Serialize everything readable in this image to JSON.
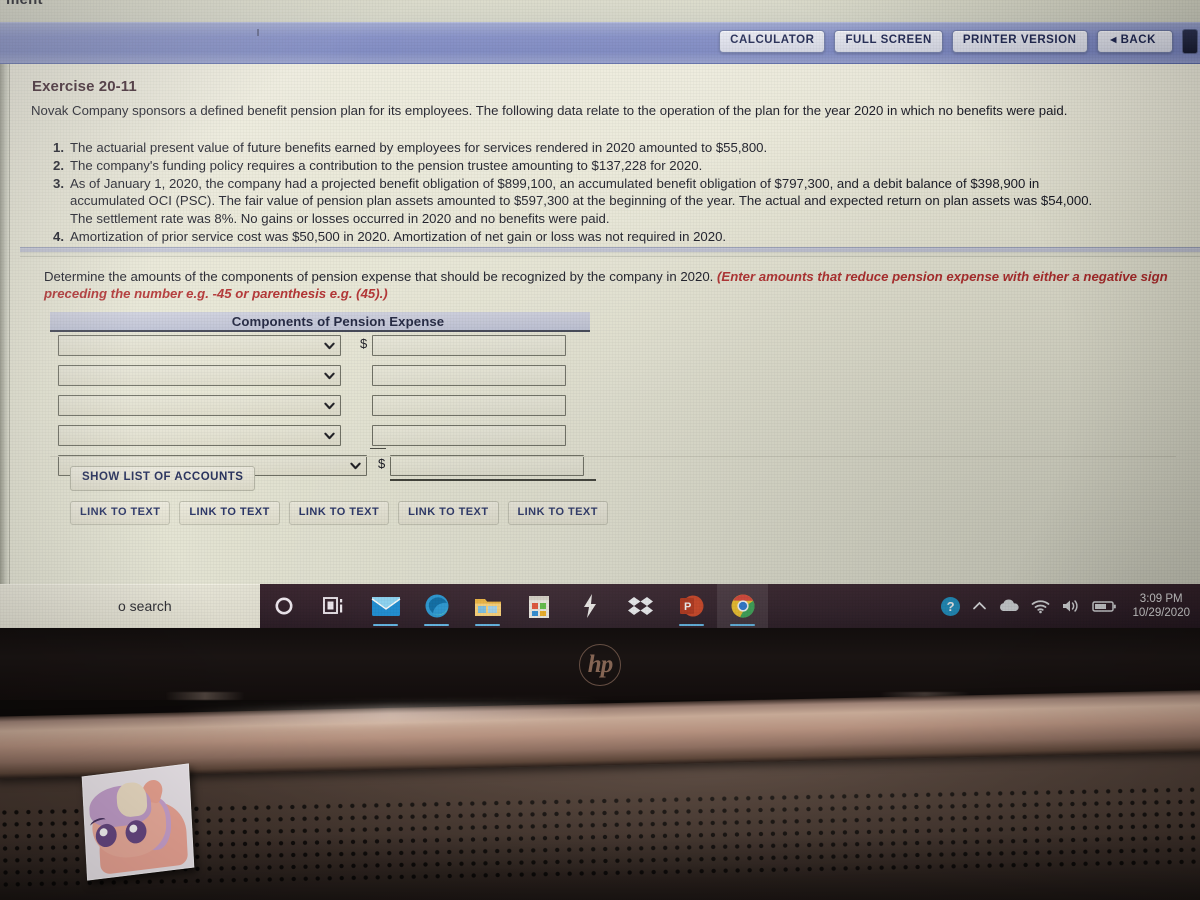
{
  "screen": {
    "top_fragment": "ment"
  },
  "toolbar": {
    "calculator": "CALCULATOR",
    "full_screen": "FULL SCREEN",
    "printer_version": "PRINTER VERSION",
    "back": "◂ BACK"
  },
  "exercise": {
    "title": "Exercise 20-11",
    "intro": "Novak Company sponsors a defined benefit pension plan for its employees. The following data relate to the operation of the plan for the year 2020 in which no benefits were paid.",
    "facts": [
      {
        "num": "1.",
        "text": "The actuarial present value of future benefits earned by employees for services rendered in 2020 amounted to $55,800.",
        "cont": ""
      },
      {
        "num": "2.",
        "text": "The company's funding policy requires a contribution to the pension trustee amounting to $137,228 for 2020.",
        "cont": ""
      },
      {
        "num": "3.",
        "text": "As of January 1, 2020, the company had a projected benefit obligation of $899,100, an accumulated benefit obligation of $797,300, and a debit balance of $398,900 in",
        "cont": "accumulated OCI (PSC). The fair value of pension plan assets amounted to $597,300 at the beginning of the year. The actual and expected return on plan assets was $54,000.",
        "cont2": "The settlement rate was 8%. No gains or losses occurred in 2020 and no benefits were paid."
      },
      {
        "num": "4.",
        "text": "Amortization of prior service cost was $50,500 in 2020. Amortization of net gain or loss was not required in 2020.",
        "cont": ""
      }
    ]
  },
  "requirement": {
    "prompt": "Determine the amounts of the components of pension expense that should be recognized by the company in 2020. ",
    "hint": "(Enter amounts that reduce pension expense with either a negative sign preceding the number e.g. -45 or parenthesis e.g. (45).)"
  },
  "worksheet": {
    "header": "Components of Pension Expense",
    "rows": [
      {
        "account": "",
        "placeholder": "",
        "amount": "",
        "dollar": "$",
        "wide": false
      },
      {
        "account": "",
        "placeholder": "",
        "amount": "",
        "dollar": "",
        "wide": false
      },
      {
        "account": "",
        "placeholder": "",
        "amount": "",
        "dollar": "",
        "wide": false
      },
      {
        "account": "",
        "placeholder": "",
        "amount": "",
        "dollar": "",
        "wide": false
      },
      {
        "account": "",
        "placeholder": "",
        "amount": "",
        "dollar": "$",
        "wide": true
      }
    ],
    "show_accounts": "SHOW LIST OF ACCOUNTS",
    "link_to_text": [
      "LINK TO TEXT",
      "LINK TO TEXT",
      "LINK TO TEXT",
      "LINK TO TEXT",
      "LINK TO TEXT"
    ]
  },
  "taskbar": {
    "search_placeholder": "o search",
    "icons": [
      "cortana-icon",
      "task-view-icon",
      "mail-icon",
      "edge-icon",
      "file-explorer-icon",
      "microsoft-store-icon",
      "lightning-icon",
      "dropbox-icon",
      "powerpoint-icon",
      "chrome-icon"
    ],
    "tray": [
      "help-icon",
      "show-hidden-icons-icon",
      "onedrive-icon",
      "wifi-icon",
      "volume-icon",
      "battery-icon"
    ],
    "time": "3:09 PM",
    "date": "10/29/2020"
  },
  "hardware": {
    "brand": "hp",
    "sticker": "pony-sticker"
  },
  "colors": {
    "header_bar": "#7d88c2",
    "page_bg": "#e7e7d6",
    "hint_red": "#b02a2a",
    "table_head": "#c3c6d8",
    "taskbar": "#34222c"
  }
}
